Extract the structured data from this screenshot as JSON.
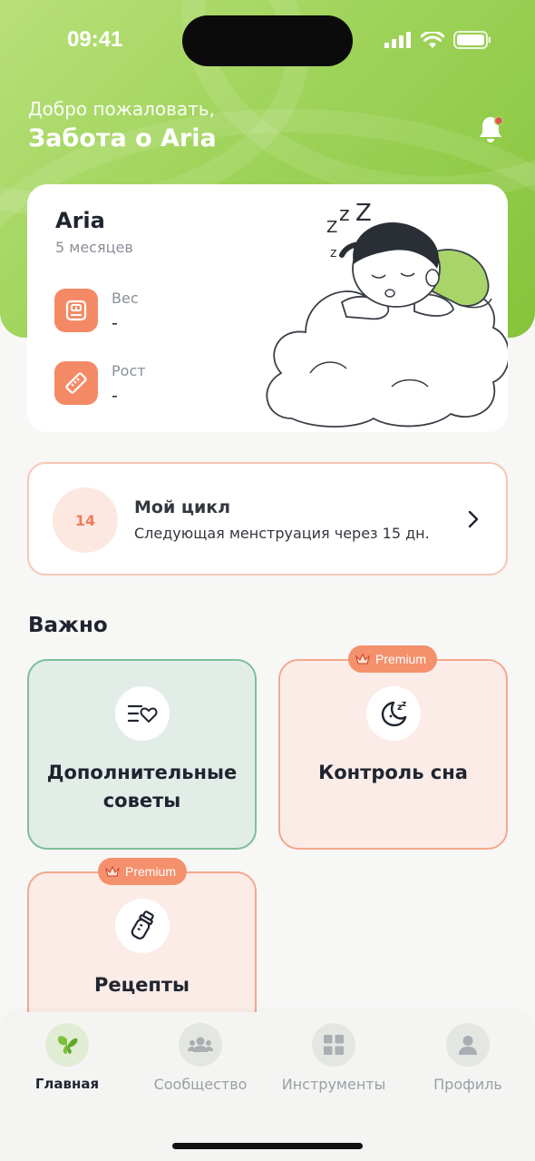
{
  "status_bar": {
    "time": "09:41"
  },
  "header": {
    "welcome": "Добро пожаловать,",
    "title": "Забота о Aria"
  },
  "child": {
    "name": "Aria",
    "age": "5 месяцев",
    "weight_label": "Вес",
    "weight_value": "-",
    "height_label": "Рост",
    "height_value": "-"
  },
  "cycle": {
    "day": "14",
    "title": "Мой цикл",
    "subtitle": "Следующая менструация через 15 дн."
  },
  "important": {
    "heading": "Важно",
    "tiles": [
      {
        "label": "Дополнительные советы",
        "premium": false,
        "icon": "list-heart-icon"
      },
      {
        "label": "Контроль сна",
        "premium": true,
        "premium_label": "Premium",
        "icon": "moon-sleep-icon"
      },
      {
        "label": "Рецепты",
        "premium": true,
        "premium_label": "Premium",
        "icon": "baby-bottle-icon"
      }
    ]
  },
  "tabs": [
    {
      "label": "Главная",
      "active": true,
      "icon": "butterfly-icon"
    },
    {
      "label": "Сообщество",
      "active": false,
      "icon": "community-icon"
    },
    {
      "label": "Инструменты",
      "active": false,
      "icon": "grid-icon"
    },
    {
      "label": "Профиль",
      "active": false,
      "icon": "user-icon"
    }
  ],
  "colors": {
    "accent": "#f48a65",
    "brand_green": "#9fd35a",
    "tile_green": "#e3ede8",
    "tile_peach": "#fbece7"
  }
}
